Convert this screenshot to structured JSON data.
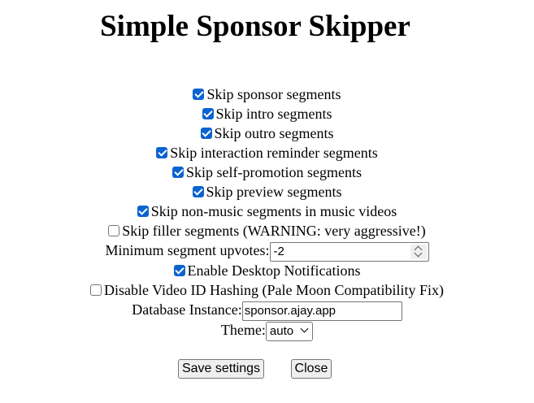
{
  "title": "Simple Sponsor Skipper",
  "options": [
    {
      "label": "Skip sponsor segments",
      "checked": true
    },
    {
      "label": "Skip intro segments",
      "checked": true
    },
    {
      "label": "Skip outro segments",
      "checked": true
    },
    {
      "label": "Skip interaction reminder segments",
      "checked": true
    },
    {
      "label": "Skip self-promotion segments",
      "checked": true
    },
    {
      "label": "Skip preview segments",
      "checked": true
    },
    {
      "label": "Skip non-music segments in music videos",
      "checked": true
    },
    {
      "label": "Skip filler segments (WARNING: very aggressive!)",
      "checked": false
    }
  ],
  "upvotes": {
    "label": "Minimum segment upvotes:",
    "value": "-2"
  },
  "notifications": {
    "label": "Enable Desktop Notifications",
    "checked": true
  },
  "hashing": {
    "label": "Disable Video ID Hashing (Pale Moon Compatibility Fix)",
    "checked": false
  },
  "database": {
    "label": "Database Instance:",
    "value": "sponsor.ajay.app"
  },
  "theme": {
    "label": "Theme:",
    "value": "auto"
  },
  "buttons": {
    "save": "Save settings",
    "close": "Close"
  },
  "colors": {
    "checkbox_accent": "#0b63d1",
    "button_bg": "#efefef"
  }
}
